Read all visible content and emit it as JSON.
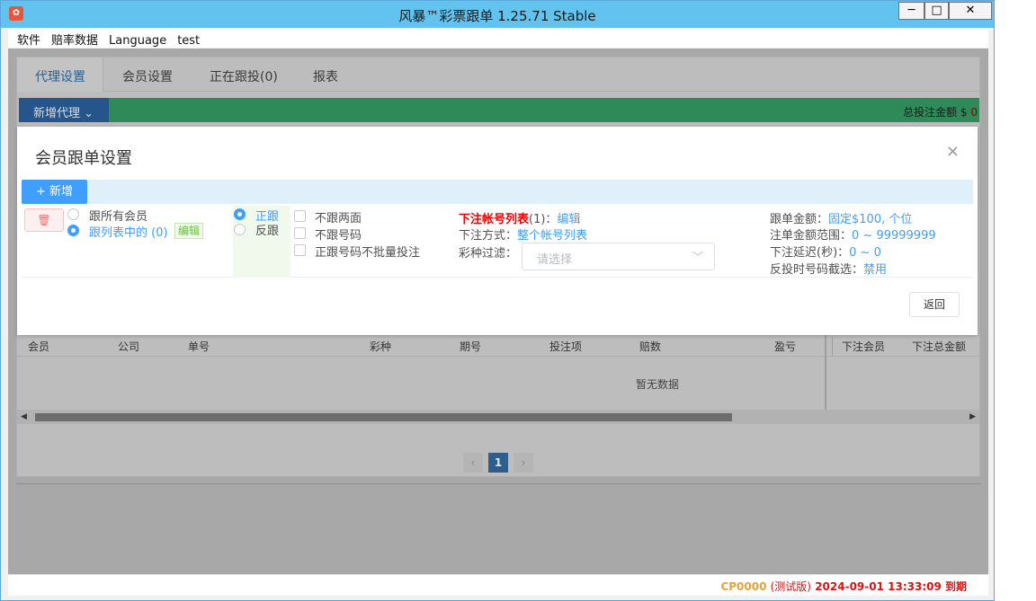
{
  "window": {
    "title": "风暴™彩票跟单 1.25.71 Stable",
    "minimize": "─",
    "maximize": "□",
    "close": "✕",
    "icon": "app-logo-icon"
  },
  "menu": [
    "软件",
    "赔率数据",
    "Language",
    "test"
  ],
  "tabs": [
    "代理设置",
    "会员设置",
    "正在跟投(0)",
    "报表"
  ],
  "agent_toolbar": {
    "add_agent": "新增代理",
    "total": "总投注金额 $",
    "total_value": "0"
  },
  "table": {
    "columns": [
      "会员",
      "公司",
      "单号",
      "彩种",
      "期号",
      "投注项",
      "赔数",
      "盈亏"
    ],
    "right_columns": [
      "下注会员",
      "下注总金额"
    ],
    "empty": "暂无数据"
  },
  "pagination": {
    "prev": "‹",
    "current": "1",
    "next": "›"
  },
  "status": {
    "code": "CP0000",
    "trial": "(测试版)",
    "expiry": "2024-09-01 13:33:09 到期"
  },
  "modal": {
    "title": "会员跟单设置",
    "close": "×",
    "add_button": "+ 新增",
    "delete_icon": "trash-icon",
    "row": {
      "member_scope": {
        "all": "跟所有会员",
        "in_list": "跟列表中的 (0)",
        "edit": "编辑",
        "selected": "in_list"
      },
      "direction": {
        "forward": "正跟",
        "reverse": "反跟",
        "selected": "forward"
      },
      "options": [
        "不跟两面",
        "不跟号码",
        "正跟号码不批量投注"
      ],
      "account_list_label": "下注帐号列表",
      "account_list_count": "(1)：",
      "account_list_edit": "编辑",
      "bet_method_label": "下注方式：",
      "bet_method_value": "整个帐号列表",
      "lottery_filter_label": "彩种过滤：",
      "lottery_filter_placeholder": "请选择",
      "follow_amount_label": "跟单金额：",
      "follow_amount_value": "固定$100, 个位",
      "bet_range_label": "注单金额范围：",
      "bet_range_value": "0 ~ 99999999",
      "delay_label": "下注延迟(秒)：",
      "delay_value": "0 ~ 0",
      "reverse_filter_label": "反投时号码截选：",
      "reverse_filter_value": "禁用"
    },
    "back_button": "返回"
  }
}
